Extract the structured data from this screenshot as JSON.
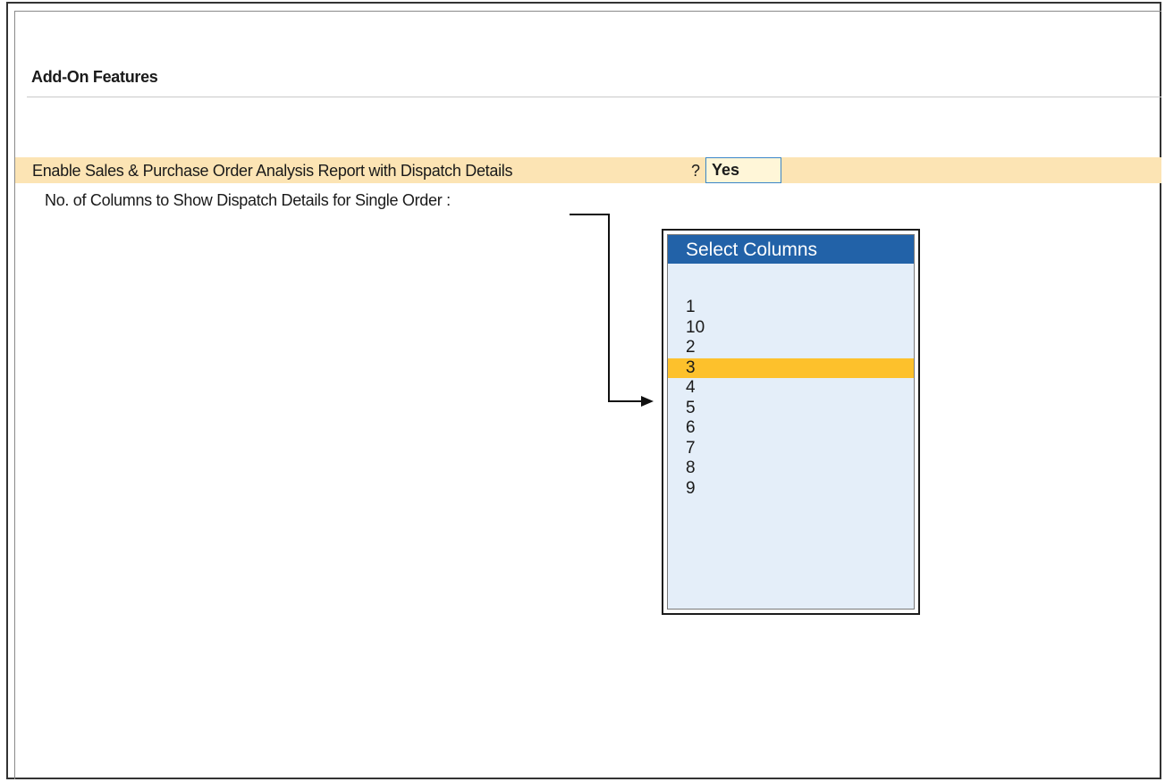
{
  "section": {
    "title": "Add-On Features"
  },
  "feature": {
    "label": "Enable Sales & Purchase Order Analysis Report with Dispatch Details",
    "question_mark": "?",
    "value": "Yes"
  },
  "sub_option": {
    "label": "No. of Columns to Show Dispatch Details for Single Order :"
  },
  "popup": {
    "title": "Select Columns",
    "items": [
      "1",
      "10",
      "2",
      "3",
      "4",
      "5",
      "6",
      "7",
      "8",
      "9"
    ],
    "selected": "3"
  },
  "colors": {
    "highlight_row": "#fce4b4",
    "popup_header": "#2262a8",
    "popup_background": "#e4eef9",
    "selected_item": "#fdc12c"
  }
}
